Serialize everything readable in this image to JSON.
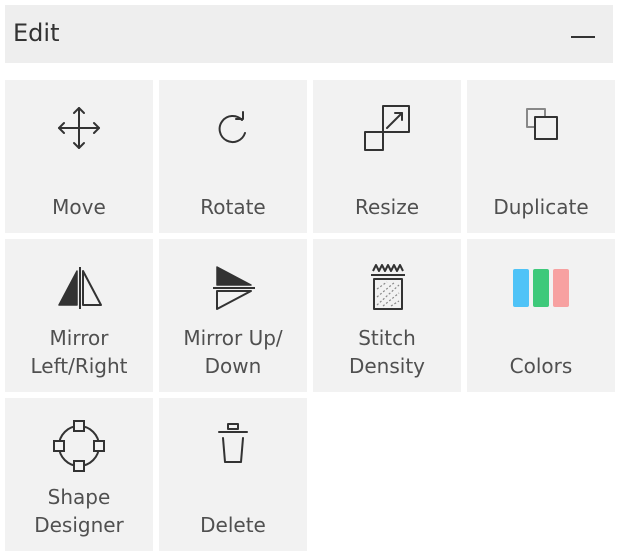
{
  "panel": {
    "title": "Edit",
    "collapse_icon": "minus-icon"
  },
  "tools": [
    {
      "id": "move",
      "icon": "move-arrows-icon",
      "lines": [
        "Move"
      ]
    },
    {
      "id": "rotate",
      "icon": "rotate-icon",
      "lines": [
        "Rotate"
      ]
    },
    {
      "id": "resize",
      "icon": "resize-icon",
      "lines": [
        "Resize"
      ]
    },
    {
      "id": "duplicate",
      "icon": "duplicate-icon",
      "lines": [
        "Duplicate"
      ]
    },
    {
      "id": "mirror-left-right",
      "icon": "mirror-horizontal-icon",
      "lines": [
        "Mirror",
        "Left/Right"
      ]
    },
    {
      "id": "mirror-up-down",
      "icon": "mirror-vertical-icon",
      "lines": [
        "Mirror Up/",
        "Down"
      ]
    },
    {
      "id": "stitch-density",
      "icon": "stitch-density-icon",
      "lines": [
        "Stitch",
        "Density"
      ]
    },
    {
      "id": "colors",
      "icon": "colors-icon",
      "lines": [
        "Colors"
      ]
    },
    {
      "id": "shape-designer",
      "icon": "shape-designer-icon",
      "lines": [
        "Shape",
        "Designer"
      ]
    },
    {
      "id": "delete",
      "icon": "trash-icon",
      "lines": [
        "Delete"
      ]
    }
  ],
  "colors": {
    "swatch_blue": "#4fc3f7",
    "swatch_green": "#3ec97a",
    "swatch_pink": "#f7a1a1"
  }
}
